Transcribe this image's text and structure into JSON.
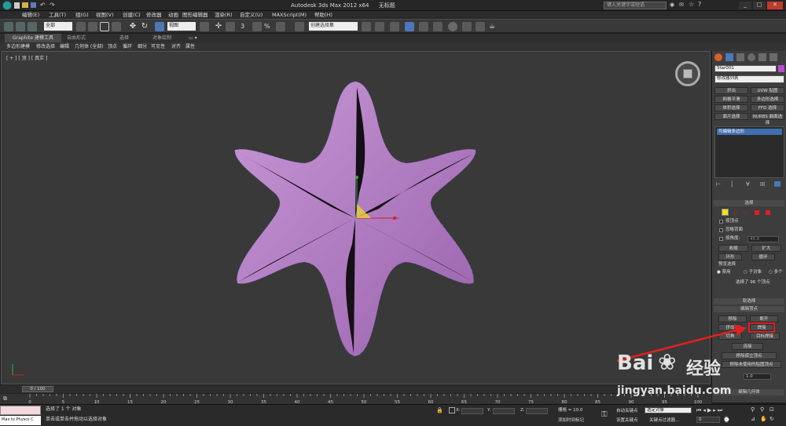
{
  "window": {
    "title": "Autodesk 3ds Max  2012 x64",
    "file": "无标题",
    "search_placeholder": "键入关键字或短语"
  },
  "menu": [
    "编辑(E)",
    "工具(T)",
    "组(G)",
    "视图(V)",
    "创建(C)",
    "修改器",
    "动画",
    "图形编辑器",
    "渲染(R)",
    "自定义(U)",
    "MAXScript(M)",
    "帮助(H)"
  ],
  "toolbar": {
    "filter_value": "全部",
    "view_value": "视图",
    "selection_set_placeholder": "创建选择集"
  },
  "ribbon": {
    "tabs": [
      "Graphite 建模工具",
      "自由形式",
      "选择",
      "对象绘制"
    ],
    "items": [
      "多边形建模",
      "修改选择",
      "编辑",
      "几何体 (全部)",
      "顶点",
      "循环",
      "细分",
      "可见性",
      "对齐",
      "属性"
    ]
  },
  "viewport": {
    "label": "[ + ] [ 顶 ] [ 真实 ]"
  },
  "panel": {
    "object_name": "Star001",
    "modifier_list": "修改器列表",
    "modifier_buttons": [
      "挤出",
      "UVW 贴图",
      "网格平滑",
      "多边形选择",
      "体积选择",
      "FFD 选择",
      "面片选择",
      "NURBS 曲面选择"
    ],
    "stack_item": "可编辑多边形",
    "selection": {
      "title": "选择",
      "by_vertex": "按顶点",
      "ignore_backfacing": "忽略背面",
      "by_angle": "按角度:",
      "angle_value": "45.0",
      "shrink": "收缩",
      "grow": "扩大",
      "ring": "环形",
      "loop": "循环",
      "preview_title": "预览选择",
      "preview_off": "禁用",
      "preview_subobj": "子对象",
      "preview_multi": "多个",
      "status": "选择了 96 个顶点"
    },
    "soft_selection": "软选择",
    "edit_vertices": {
      "title": "编辑顶点",
      "remove": "移除",
      "break": "断开",
      "extrude": "挤出",
      "weld": "焊接",
      "chamfer": "切角",
      "target_weld": "目标焊接",
      "connect": "连接",
      "remove_isolated": "移除孤立顶点",
      "remove_unused_map": "移除未使用的贴图顶点",
      "weight_value": "1.0"
    },
    "edit_geometry": "编辑几何体"
  },
  "timeline": {
    "frame": "0 / 100",
    "ticks": [
      "0",
      "5",
      "10",
      "15",
      "20",
      "25",
      "30",
      "35",
      "40",
      "45",
      "50",
      "55",
      "60",
      "65",
      "70",
      "75",
      "80",
      "85",
      "90",
      "95",
      "100"
    ]
  },
  "status": {
    "script_label": "Max to Physcs C",
    "selected": "选择了 1 个 对象",
    "hint": "单击或单击并拖动以选择对象",
    "x_label": "X:",
    "y_label": "Y:",
    "z_label": "Z:",
    "grid": "栅格 = 10.0",
    "add_time_tag": "添加时间标记",
    "auto_key": "自动关键点",
    "selected_object": "选定对象",
    "set_key": "设置关键点",
    "key_filters": "关键点过滤器...",
    "frame_value": "0"
  },
  "watermark": {
    "brand": "Bai",
    "brand2": "经验",
    "url": "jingyan.baidu.com"
  },
  "colors": {
    "shape": "#b985c9",
    "accent_red": "#e02020",
    "stack_highlight": "#3d6fb0"
  }
}
